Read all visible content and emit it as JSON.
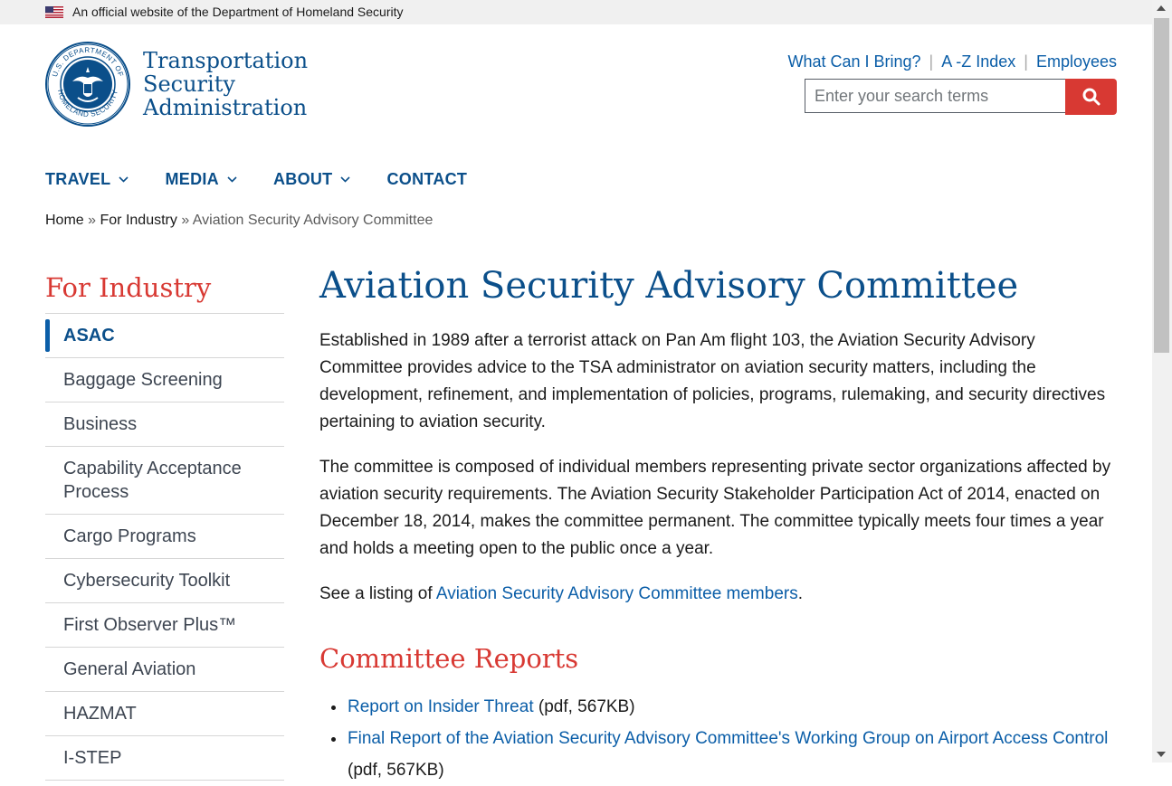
{
  "banner": {
    "text": "An official website of the Department of Homeland Security"
  },
  "logo": {
    "seal_top": "U.S. DEPARTMENT OF",
    "seal_bottom": "HOMELAND SECURITY",
    "line1": "Transportation",
    "line2": "Security",
    "line3": "Administration"
  },
  "utility": {
    "link1": "What Can I Bring?",
    "link2": "A -Z Index",
    "link3": "Employees"
  },
  "search": {
    "placeholder": "Enter your search terms"
  },
  "nav": [
    {
      "label": "TRAVEL"
    },
    {
      "label": "MEDIA"
    },
    {
      "label": "ABOUT"
    },
    {
      "label": "CONTACT"
    }
  ],
  "breadcrumb": {
    "home": "Home",
    "sep": "»",
    "parent": "For Industry",
    "current": "Aviation Security Advisory Committee"
  },
  "sidebar": {
    "title": "For Industry",
    "items": [
      {
        "label": "ASAC"
      },
      {
        "label": "Baggage Screening"
      },
      {
        "label": "Business"
      },
      {
        "label": "Capability Acceptance Process"
      },
      {
        "label": "Cargo Programs"
      },
      {
        "label": "Cybersecurity Toolkit"
      },
      {
        "label": "First Observer Plus™"
      },
      {
        "label": "General Aviation"
      },
      {
        "label": "HAZMAT"
      },
      {
        "label": "I-STEP"
      }
    ]
  },
  "main": {
    "title": "Aviation Security Advisory Committee",
    "p1": "Established in 1989 after a terrorist attack on Pan Am flight 103, the Aviation Security Advisory Committee provides advice to the TSA administrator on aviation security matters, including the development, refinement, and implementation of policies, programs, rulemaking, and security directives pertaining to aviation security.",
    "p2": "The committee is composed of individual members representing private sector organizations affected by aviation security requirements. The Aviation Security Stakeholder Participation Act of 2014, enacted on December 18, 2014, makes the committee permanent. The committee typically meets four times a year and holds a meeting open to the public once a year.",
    "p3_prefix": "See a listing of ",
    "p3_link": "Aviation Security Advisory Committee members",
    "p3_suffix": ".",
    "reports_title": "Committee Reports",
    "reports": [
      {
        "link": "Report on Insider Threat",
        "meta": " (pdf, 567KB)"
      },
      {
        "link": "Final Report of the Aviation Security Advisory Committee's Working Group on Airport Access Control",
        "meta": " (pdf, 567KB)"
      }
    ]
  },
  "colors": {
    "navy": "#0b4f8a",
    "link": "#0b5ea8",
    "red": "#d83933"
  }
}
